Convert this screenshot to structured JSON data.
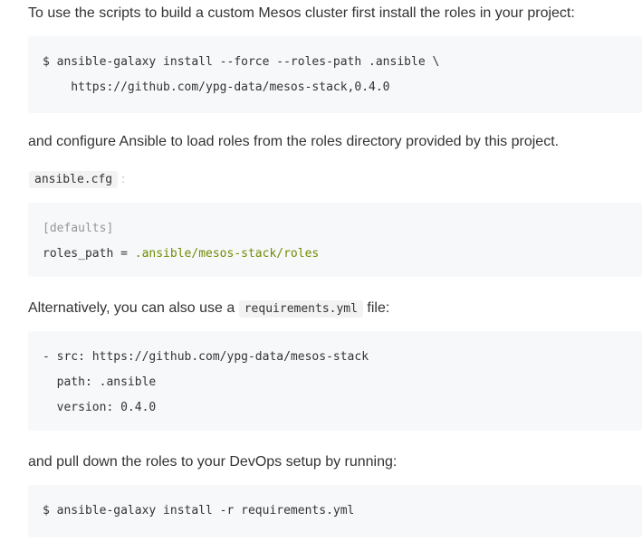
{
  "paragraphs": {
    "p1": "To use the scripts to build a custom Mesos cluster first install the roles in your project:",
    "p2": "and configure Ansible to load roles from the roles directory provided by this project.",
    "p3_before": "Alternatively, you can also use a",
    "p3_code": "requirements.yml",
    "p3_after": "file:",
    "p4": "and pull down the roles to your DevOps setup by running:"
  },
  "code_blocks": {
    "install_cmd": {
      "line1": "$ ansible-galaxy install --force --roles-path .ansible \\",
      "line2": "    https://github.com/ypg-data/mesos-stack,0.4.0"
    },
    "cfg_label": "ansible.cfg",
    "cfg_colon": ":",
    "ansible_cfg": {
      "section": "[defaults]",
      "key": "roles_path = ",
      "value": ".ansible/mesos-stack/roles"
    },
    "requirements": {
      "line1": "- src: https://github.com/ypg-data/mesos-stack",
      "line2": "  path: .ansible",
      "line3": "  version: 0.4.0"
    },
    "pull_cmd": {
      "line1": "$ ansible-galaxy install -r requirements.yml"
    }
  },
  "colors": {
    "text": "#333333",
    "code_background": "#f6f8fa",
    "comment": "#969896",
    "string": "#718c00"
  }
}
